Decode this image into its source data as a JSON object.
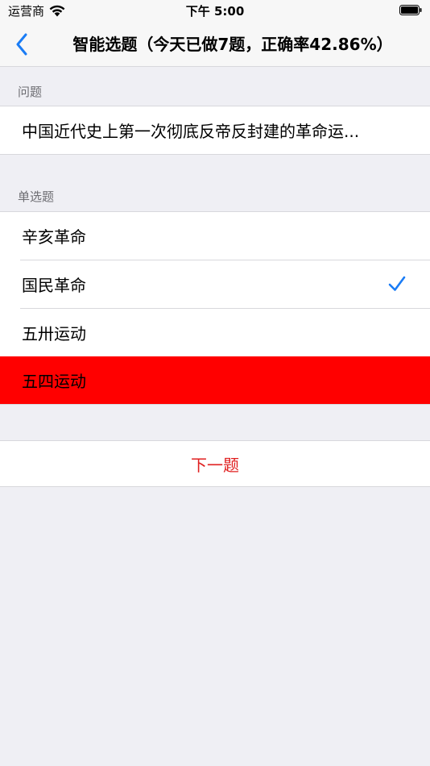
{
  "status_bar": {
    "carrier": "运营商",
    "time": "下午 5:00",
    "icons": [
      "wifi-icon",
      "battery-icon"
    ]
  },
  "nav": {
    "back_icon": "chevron-left-icon",
    "title": "智能选题（今天已做7题，正确率42.86%）"
  },
  "question_section": {
    "header": "问题",
    "text": "中国近代史上第一次彻底反帝反封建的革命运..."
  },
  "options_section": {
    "header": "单选题",
    "options": [
      {
        "label": "辛亥革命",
        "state": "normal"
      },
      {
        "label": "国民革命",
        "state": "correct"
      },
      {
        "label": "五卅运动",
        "state": "normal"
      },
      {
        "label": "五四运动",
        "state": "selected-wrong"
      }
    ]
  },
  "next_button": {
    "label": "下一题"
  },
  "colors": {
    "accent": "#1a7cf5",
    "wrong_bg": "#ff0000",
    "next_text": "#e02020",
    "background": "#efeff4"
  }
}
